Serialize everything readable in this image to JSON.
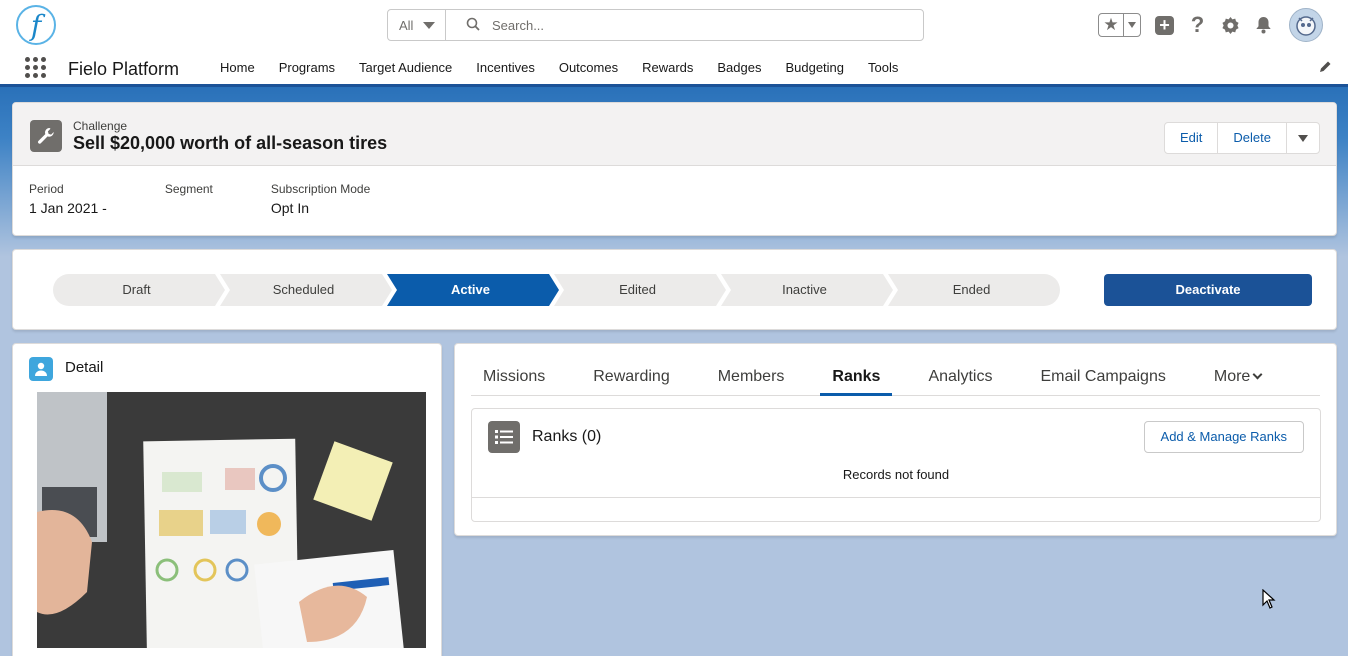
{
  "global_header": {
    "logo_letter": "f",
    "search_scope": "All",
    "search_placeholder": "Search..."
  },
  "app_nav": {
    "app_name": "Fielo Platform",
    "items": [
      "Home",
      "Programs",
      "Target Audience",
      "Incentives",
      "Outcomes",
      "Rewards",
      "Badges",
      "Budgeting",
      "Tools"
    ]
  },
  "record": {
    "entity": "Challenge",
    "title": "Sell $20,000 worth of all-season tires",
    "actions": {
      "edit": "Edit",
      "delete": "Delete"
    },
    "fields": [
      {
        "label": "Period",
        "value": "1 Jan 2021 -"
      },
      {
        "label": "Segment",
        "value": ""
      },
      {
        "label": "Subscription Mode",
        "value": "Opt In"
      }
    ]
  },
  "path": {
    "stages": [
      "Draft",
      "Scheduled",
      "Active",
      "Edited",
      "Inactive",
      "Ended"
    ],
    "active_stage": "Active",
    "action_label": "Deactivate"
  },
  "detail": {
    "title": "Detail"
  },
  "tabs": {
    "items": [
      "Missions",
      "Rewarding",
      "Members",
      "Ranks",
      "Analytics",
      "Email Campaigns"
    ],
    "more_label": "More",
    "active": "Ranks"
  },
  "ranks": {
    "title": "Ranks (0)",
    "add_label": "Add & Manage Ranks",
    "empty_message": "Records not found"
  },
  "colors": {
    "brand": "#1b5297",
    "link": "#0b5cab",
    "background": "#b0c4df"
  }
}
